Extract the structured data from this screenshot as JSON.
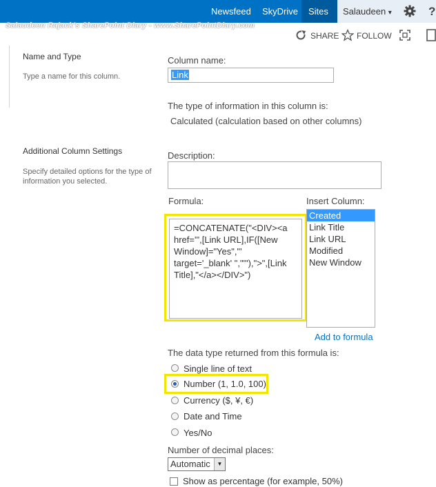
{
  "suitebar": {
    "nav": [
      "Newsfeed",
      "SkyDrive",
      "Sites"
    ],
    "user": "Salaudeen",
    "user_caret": "▾"
  },
  "watermark": "Salaudeen Rajack's SharePoint Diary - www.SharePointDiary.com",
  "actions": {
    "share": "SHARE",
    "follow": "FOLLOW"
  },
  "name_type": {
    "title": "Name and Type",
    "desc": "Type a name for this column.",
    "column_name_label": "Column name:",
    "column_name_value": "Link",
    "type_label": "The type of information in this column is:",
    "type_value": "Calculated (calculation based on other columns)"
  },
  "additional": {
    "title": "Additional Column Settings",
    "desc": "Specify detailed options for the type of information you selected.",
    "description_label": "Description:",
    "formula_label": "Formula:",
    "formula_lines": [
      "=CONCATENATE(\"<DIV><a",
      "href='\",[Link URL],IF([New",
      "Window]=\"Yes\",\"'",
      "target='_blank' \",\"'\"),\">\",[Link",
      "Title],\"</a></DIV>\")"
    ],
    "insert_column_label": "Insert Column:",
    "insert_columns": [
      "Created",
      "Link Title",
      "Link URL",
      "Modified",
      "New Window"
    ],
    "add_to_formula": "Add to formula",
    "datatype_label": "The data type returned from this formula is:",
    "datatypes": [
      "Single line of text",
      "Number (1, 1.0, 100)",
      "Currency ($, ¥, €)",
      "Date and Time",
      "Yes/No"
    ],
    "selected_datatype": "Number (1, 1.0, 100)",
    "decimal_label": "Number of decimal places:",
    "decimal_value": "Automatic",
    "percentage_label": "Show as percentage (for example, 50%)"
  }
}
